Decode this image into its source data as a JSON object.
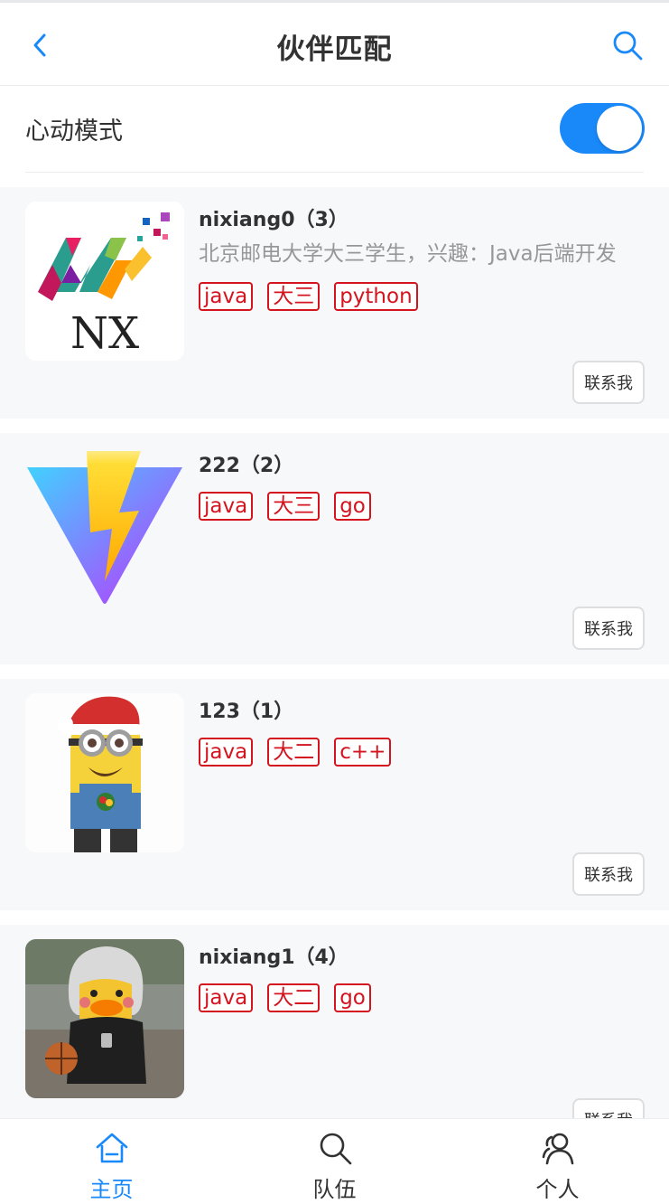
{
  "nav": {
    "title": "伙伴匹配",
    "back_icon": "chevron-left-icon",
    "search_icon": "search-icon"
  },
  "mode": {
    "label": "心动模式",
    "enabled": true
  },
  "users": [
    {
      "title": "nixiang0（3）",
      "description": "北京邮电大学大三学生，兴趣：Java后端开发",
      "tags": [
        "java",
        "大三",
        "python"
      ],
      "contact_label": "联系我",
      "avatar": "nx-logo-avatar"
    },
    {
      "title": "222（2）",
      "description": "",
      "tags": [
        "java",
        "大三",
        "go"
      ],
      "contact_label": "联系我",
      "avatar": "vite-logo-avatar"
    },
    {
      "title": "123（1）",
      "description": "",
      "tags": [
        "java",
        "大二",
        "c++"
      ],
      "contact_label": "联系我",
      "avatar": "minion-avatar"
    },
    {
      "title": "nixiang1（4）",
      "description": "",
      "tags": [
        "java",
        "大二",
        "go"
      ],
      "contact_label": "联系我",
      "avatar": "duck-avatar"
    }
  ],
  "tabbar": {
    "items": [
      {
        "label": "主页",
        "icon": "home-icon",
        "active": true
      },
      {
        "label": "队伍",
        "icon": "search-icon",
        "active": false
      },
      {
        "label": "个人",
        "icon": "user-icon",
        "active": false
      }
    ]
  },
  "colors": {
    "primary": "#1989fa",
    "tag": "#d4141e",
    "card_bg": "#f7f8fa"
  }
}
